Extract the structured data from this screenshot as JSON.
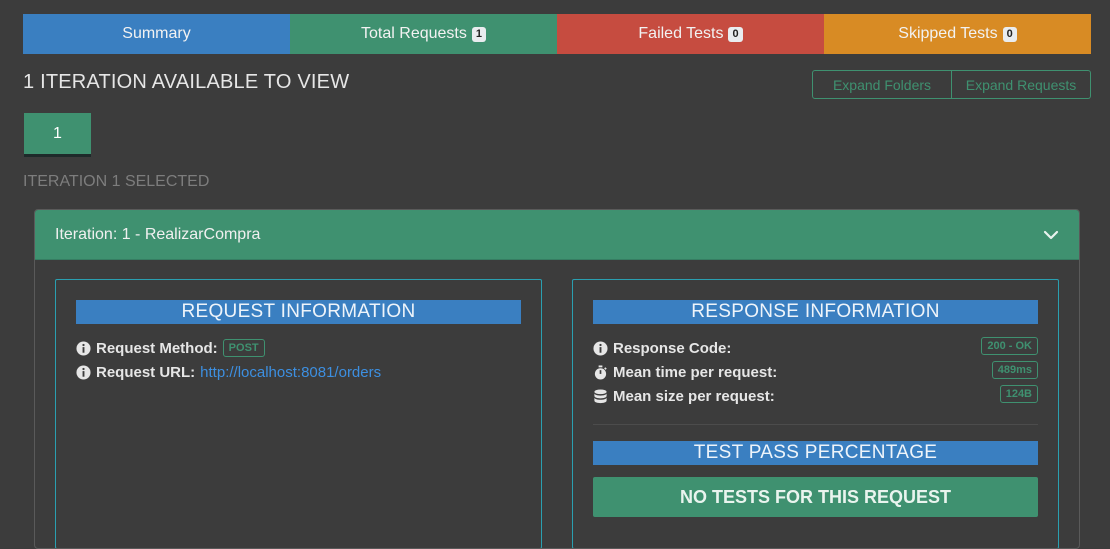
{
  "tabs": [
    {
      "label": "Summary"
    },
    {
      "label": "Total Requests",
      "badge": "1"
    },
    {
      "label": "Failed Tests",
      "badge": "0"
    },
    {
      "label": "Skipped Tests",
      "badge": "0"
    }
  ],
  "header": {
    "title": "1 ITERATION AVAILABLE TO VIEW",
    "expand_folders": "Expand Folders",
    "expand_requests": "Expand Requests"
  },
  "iterations": {
    "button": "1",
    "selected_text": "ITERATION 1 SELECTED"
  },
  "card": {
    "title": "Iteration: 1 - RealizarCompra"
  },
  "request": {
    "heading": "REQUEST INFORMATION",
    "method_label": "Request Method:",
    "method_value": "POST",
    "url_label": "Request URL:",
    "url_value": "http://localhost:8081/orders"
  },
  "response": {
    "heading": "RESPONSE INFORMATION",
    "code_label": "Response Code:",
    "code_value": "200 - OK",
    "time_label": "Mean time per request:",
    "time_value": "489ms",
    "size_label": "Mean size per request:",
    "size_value": "124B",
    "test_heading": "TEST PASS PERCENTAGE",
    "no_tests": "NO TESTS FOR THIS REQUEST"
  },
  "colors": {
    "summary": "#3a7fc1",
    "success": "#3f9170",
    "danger": "#c64c40",
    "warning": "#d88b24",
    "link": "#3d8fe0",
    "panel_border": "#2a9fb0"
  },
  "icons": [
    "info-circle-icon",
    "stopwatch-icon",
    "database-icon",
    "chevron-down-icon"
  ]
}
